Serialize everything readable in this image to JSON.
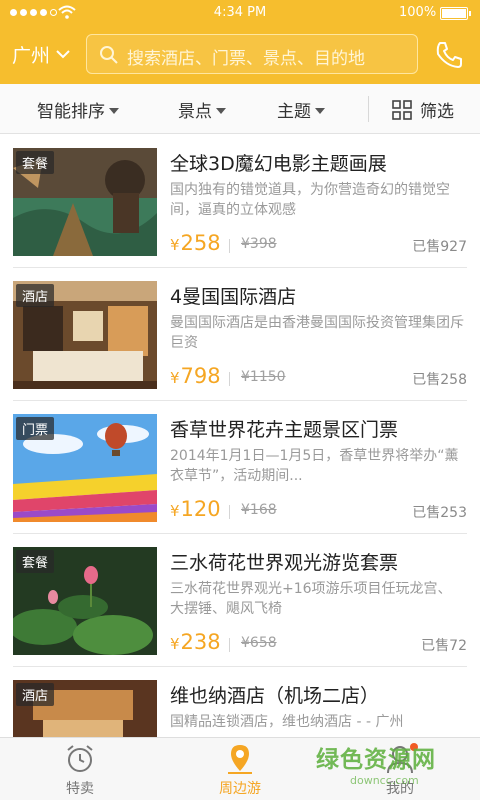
{
  "status_bar": {
    "time": "4:34 PM",
    "battery": "100%"
  },
  "header": {
    "city": "广州",
    "search_placeholder": "搜索酒店、门票、景点、目的地"
  },
  "filters": {
    "sort": "智能排序",
    "scenic": "景点",
    "theme": "主题",
    "filter": "筛选"
  },
  "items": [
    {
      "tag": "套餐",
      "title": "全球3D魔幻电影主题画展",
      "desc": "国内独有的错觉道具，为你营造奇幻的错觉空间，逼真的立体观感",
      "price_symbol": "¥",
      "price": "258",
      "original_price": "¥398",
      "sold": "已售927"
    },
    {
      "tag": "酒店",
      "title": "4曼国国际酒店",
      "desc": "曼国国际酒店是由香港曼国国际投资管理集团斥巨资",
      "price_symbol": "¥",
      "price": "798",
      "original_price": "¥1150",
      "sold": "已售258"
    },
    {
      "tag": "门票",
      "title": "香草世界花卉主题景区门票",
      "desc": "2014年1月1日—1月5日，香草世界将举办“薰衣草节”，活动期间...",
      "price_symbol": "¥",
      "price": "120",
      "original_price": "¥168",
      "sold": "已售253"
    },
    {
      "tag": "套餐",
      "title": "三水荷花世界观光游览套票",
      "desc": "三水荷花世界观光+16项游乐项目任玩龙宫、大摆锤、飓风飞椅",
      "price_symbol": "¥",
      "price": "238",
      "original_price": "¥658",
      "sold": "已售72"
    },
    {
      "tag": "酒店",
      "title": "维也纳酒店（机场二店）",
      "desc": "国精品连锁酒店，维也纳酒店 - - 广州",
      "price_symbol": "¥",
      "price": "",
      "original_price": "",
      "sold": ""
    }
  ],
  "tabbar": {
    "deals": "特卖",
    "nearby": "周边游",
    "mine": "我的"
  },
  "watermark": {
    "main": "绿色资源网",
    "sub": "downcc.com"
  },
  "colors": {
    "brand": "#f6be2e",
    "price": "#f5a623",
    "active_tab": "#f5a623"
  }
}
